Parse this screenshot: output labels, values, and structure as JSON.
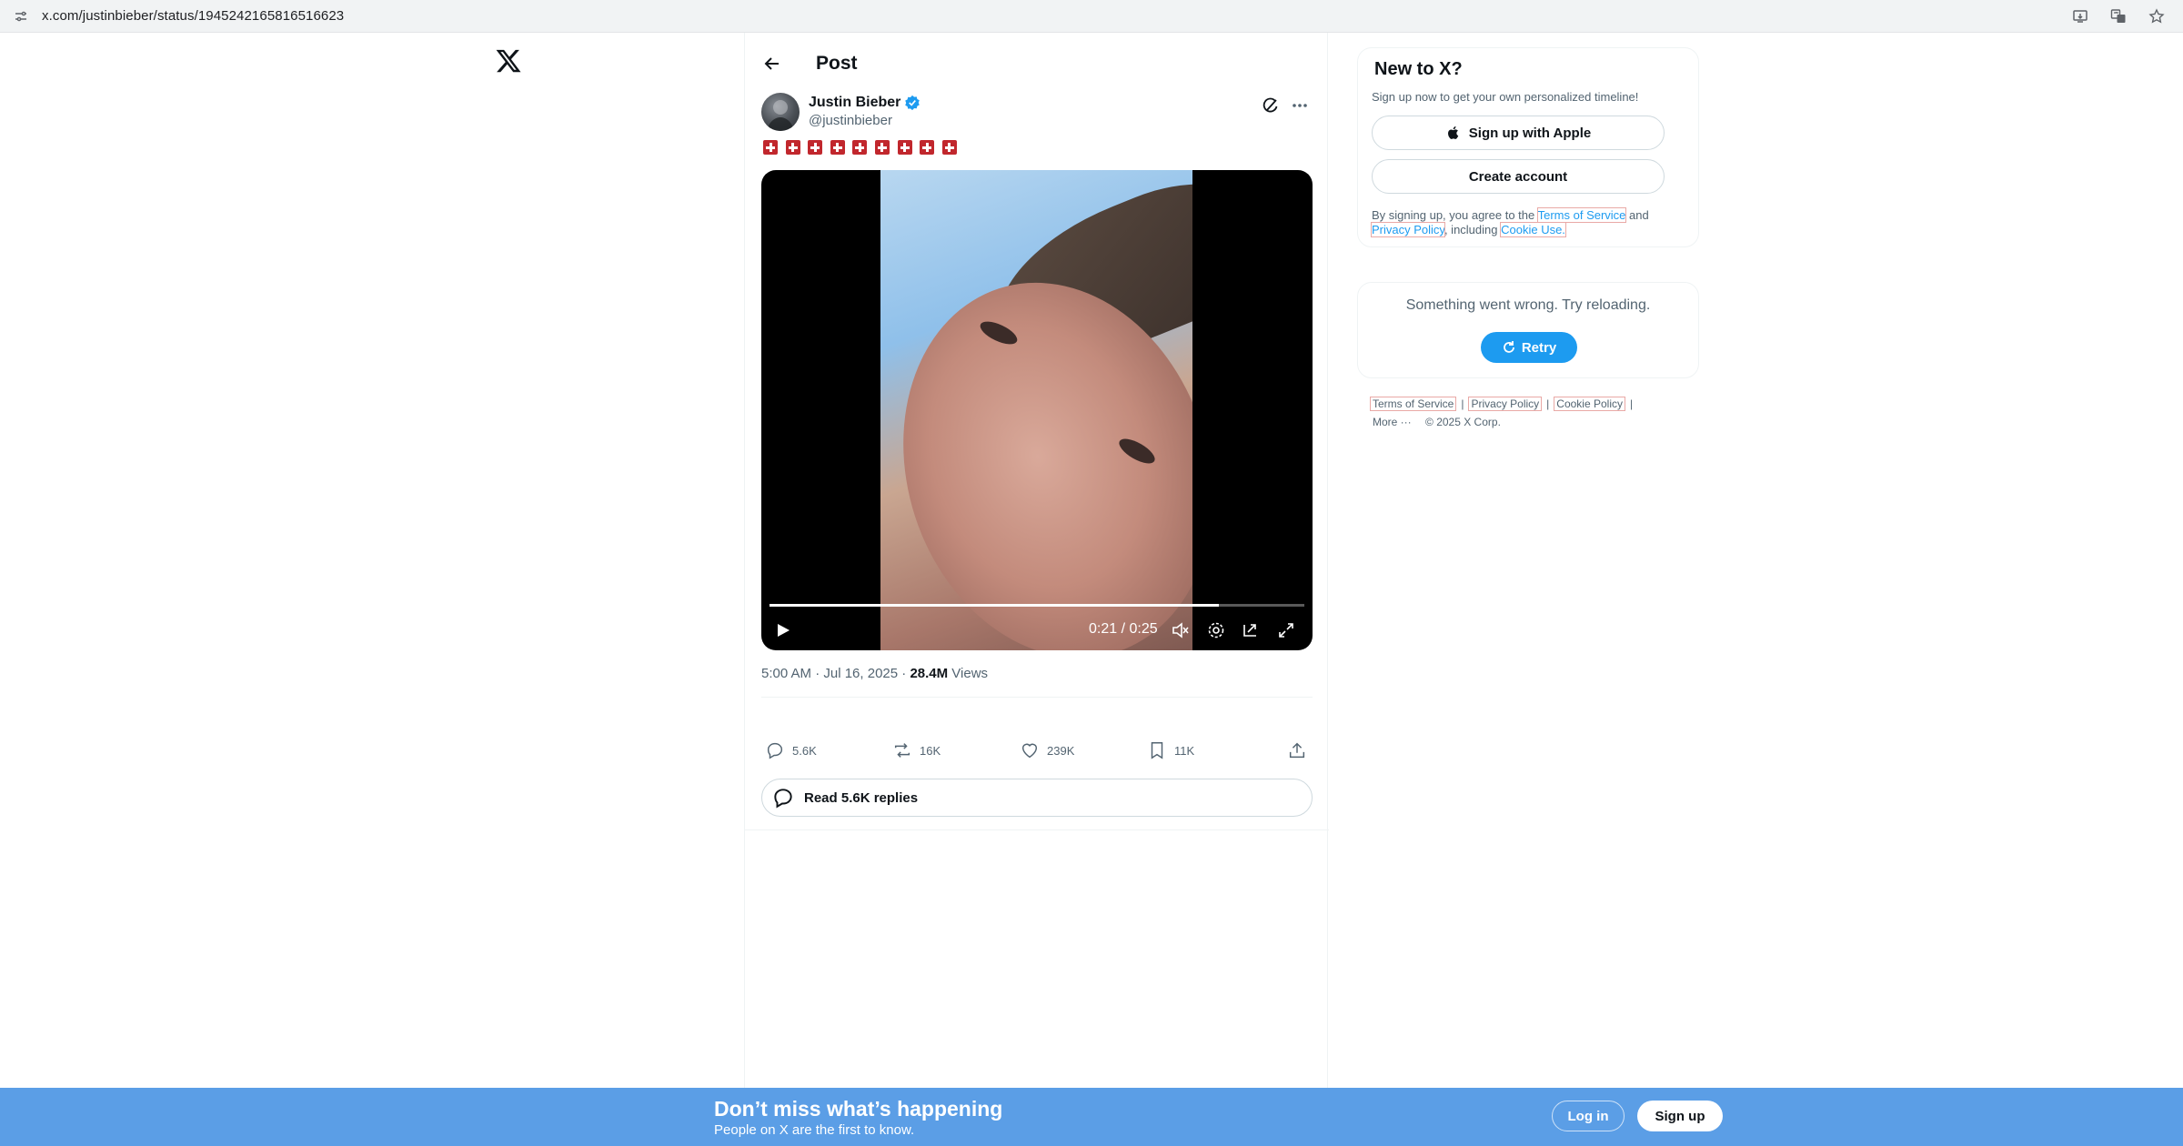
{
  "browser": {
    "url": "x.com/justinbieber/status/1945242165816516623"
  },
  "post": {
    "header_title": "Post",
    "author_name": "Justin Bieber",
    "author_handle": "@justinbieber",
    "emoji_count": 9,
    "emoji_description": "red-cross-flag",
    "video": {
      "time": "0:21 / 0:25",
      "progress_fraction": 0.84
    },
    "time": "5:00 AM · Jul 16, 2025 · ",
    "views_count": "28.4M",
    "views_label": " Views",
    "replies": "5.6K",
    "reposts": "16K",
    "likes": "239K",
    "bookmarks": "11K",
    "read_replies": "Read 5.6K replies"
  },
  "sidebar": {
    "new_title": "New to X?",
    "new_subtitle": "Sign up now to get your own personalized timeline!",
    "apple_button": "Sign up with Apple",
    "create_button": "Create account",
    "terms_prefix": "By signing up, you agree to the ",
    "terms_link": "Terms of Service",
    "terms_and": " and ",
    "privacy_link": "Privacy Policy",
    "terms_including": ", including ",
    "cookie_link": "Cookie Use.",
    "error_text": "Something went wrong. Try reloading.",
    "retry_label": "Retry"
  },
  "footer": {
    "terms": "Terms of Service",
    "privacy": "Privacy Policy",
    "cookie": "Cookie Policy",
    "sep": "|",
    "more": "More ···",
    "copyright": "© 2025 X Corp."
  },
  "bottom_bar": {
    "title": "Don’t miss what’s happening",
    "subtitle": "People on X are the first to know.",
    "login": "Log in",
    "signup": "Sign up"
  },
  "colors": {
    "accent": "#1d9bf0",
    "bottom_bar": "#5b9ee6",
    "text_secondary": "#536471"
  }
}
